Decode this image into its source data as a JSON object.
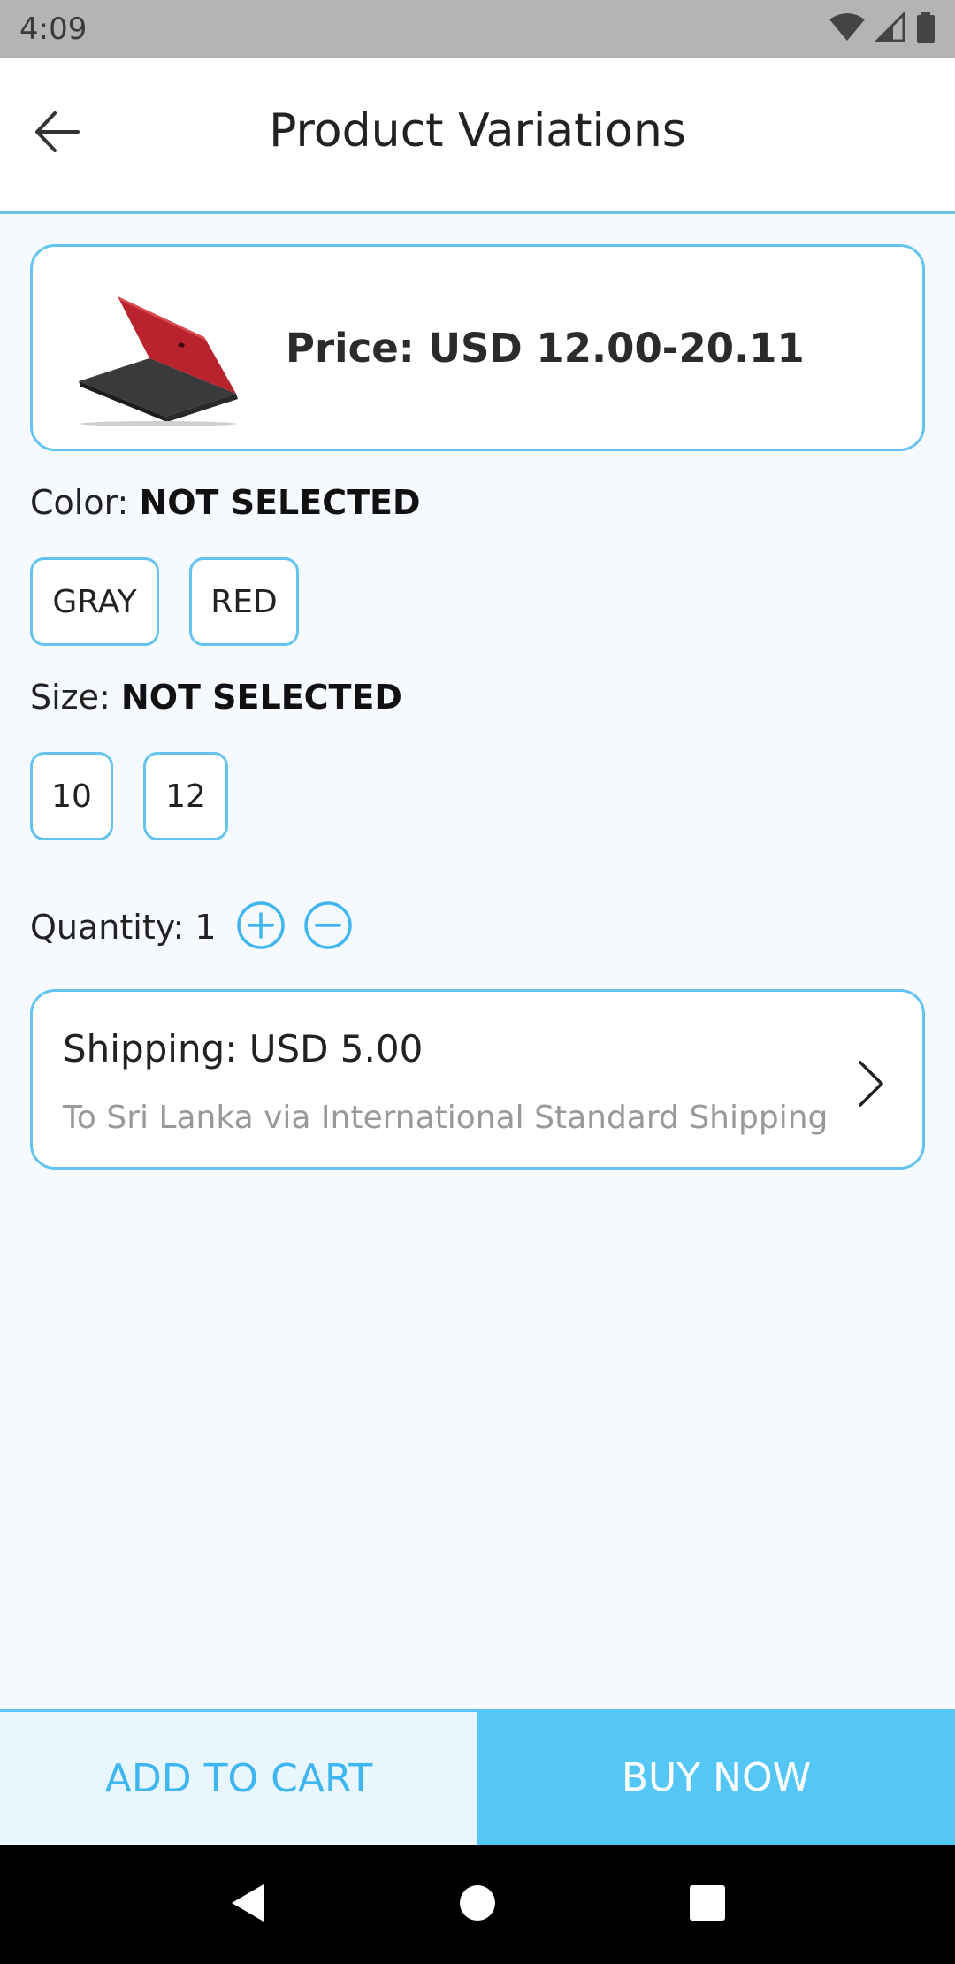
{
  "status_bar": {
    "time": "4:09",
    "icons": [
      "wifi-icon",
      "cell-signal-icon",
      "battery-icon"
    ]
  },
  "header": {
    "title": "Product Variations",
    "back_icon": "arrow-left-icon"
  },
  "product": {
    "price": "Price: USD 12.00-20.11",
    "image": "red-laptop"
  },
  "color": {
    "label": "Color:",
    "value": "NOT SELECTED",
    "options": [
      "GRAY",
      "RED"
    ]
  },
  "size": {
    "label": "Size:",
    "value": "NOT SELECTED",
    "options": [
      "10",
      "12"
    ]
  },
  "quantity": {
    "label": "Quantity:",
    "value": "1"
  },
  "shipping": {
    "title": "Shipping: USD 5.00",
    "subtitle": "To Sri Lanka via International Standard Shipping"
  },
  "actions": {
    "add_to_cart": "ADD TO CART",
    "buy_now": "BUY NOW"
  },
  "colors": {
    "accent": "#55c7f7",
    "border": "#64c4ee",
    "background": "#f6faff"
  }
}
